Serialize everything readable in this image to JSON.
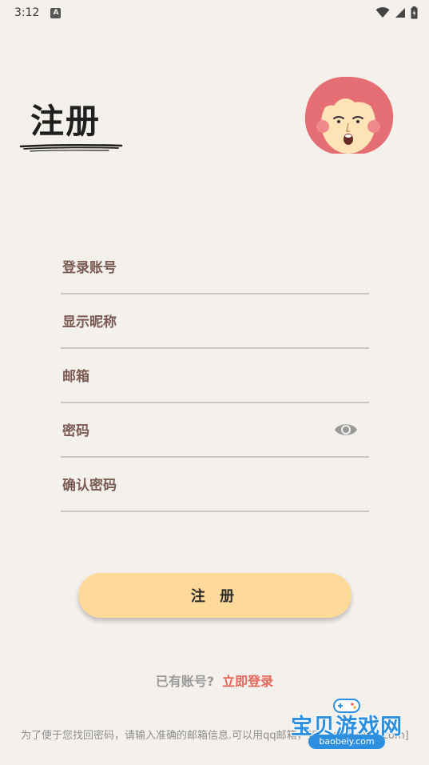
{
  "status_bar": {
    "time": "3:12",
    "notification_badge": "A",
    "icons": [
      "wifi-icon",
      "signal-icon",
      "battery-charging-icon"
    ]
  },
  "header": {
    "title": "注册",
    "avatar_icon": "girl-avatar-icon"
  },
  "form": {
    "account_placeholder": "登录账号",
    "nickname_placeholder": "显示昵称",
    "email_placeholder": "邮箱",
    "password_placeholder": "密码",
    "confirm_password_placeholder": "确认密码",
    "password_toggle_icon": "eye-icon"
  },
  "actions": {
    "register_label": "注 册",
    "have_account_text": "已有账号?",
    "login_link_label": "立即登录"
  },
  "footer": {
    "note": "为了便于您找回密码，请输入准确的邮箱信息.可以用qq邮箱，如：[qq号@qq.com]"
  },
  "watermark": {
    "title": "宝贝游戏网",
    "url": "baobeiy.com"
  },
  "colors": {
    "background": "#f4f1ed",
    "button": "#fdd99a",
    "link": "#e5675b",
    "field_text": "#7a5a52",
    "avatar_hair": "#e46e73"
  }
}
